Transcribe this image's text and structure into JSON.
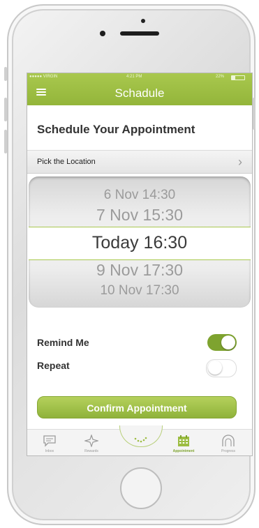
{
  "status_bar": {
    "carrier": "●●●●● VIRGIN",
    "time": "4:21 PM",
    "battery": "22%"
  },
  "header": {
    "title": "Schadule"
  },
  "page": {
    "heading": "Schedule Your Appointment"
  },
  "location": {
    "label": "Pick the Location"
  },
  "picker": {
    "rows": [
      "6 Nov  14:30",
      "7 Nov  15:30",
      "Today 16:30",
      "9 Nov  17:30",
      "10 Nov 17:30"
    ],
    "selected_index": 2
  },
  "options": {
    "remind": {
      "label": "Remind Me",
      "on": true
    },
    "repeat": {
      "label": "Repeat",
      "on": false
    }
  },
  "confirm": {
    "label": "Confirm Appointment"
  },
  "tabs": [
    {
      "label": "Inbox",
      "icon": "chat-bubble-icon"
    },
    {
      "label": "Rewards",
      "icon": "star-icon"
    },
    {
      "label": "",
      "icon": "center-action-icon"
    },
    {
      "label": "Appointment",
      "icon": "calendar-icon"
    },
    {
      "label": "Progress",
      "icon": "arch-icon"
    }
  ],
  "colors": {
    "accent": "#9cbd42",
    "accent_dark": "#7ea32f",
    "text": "#333333"
  }
}
